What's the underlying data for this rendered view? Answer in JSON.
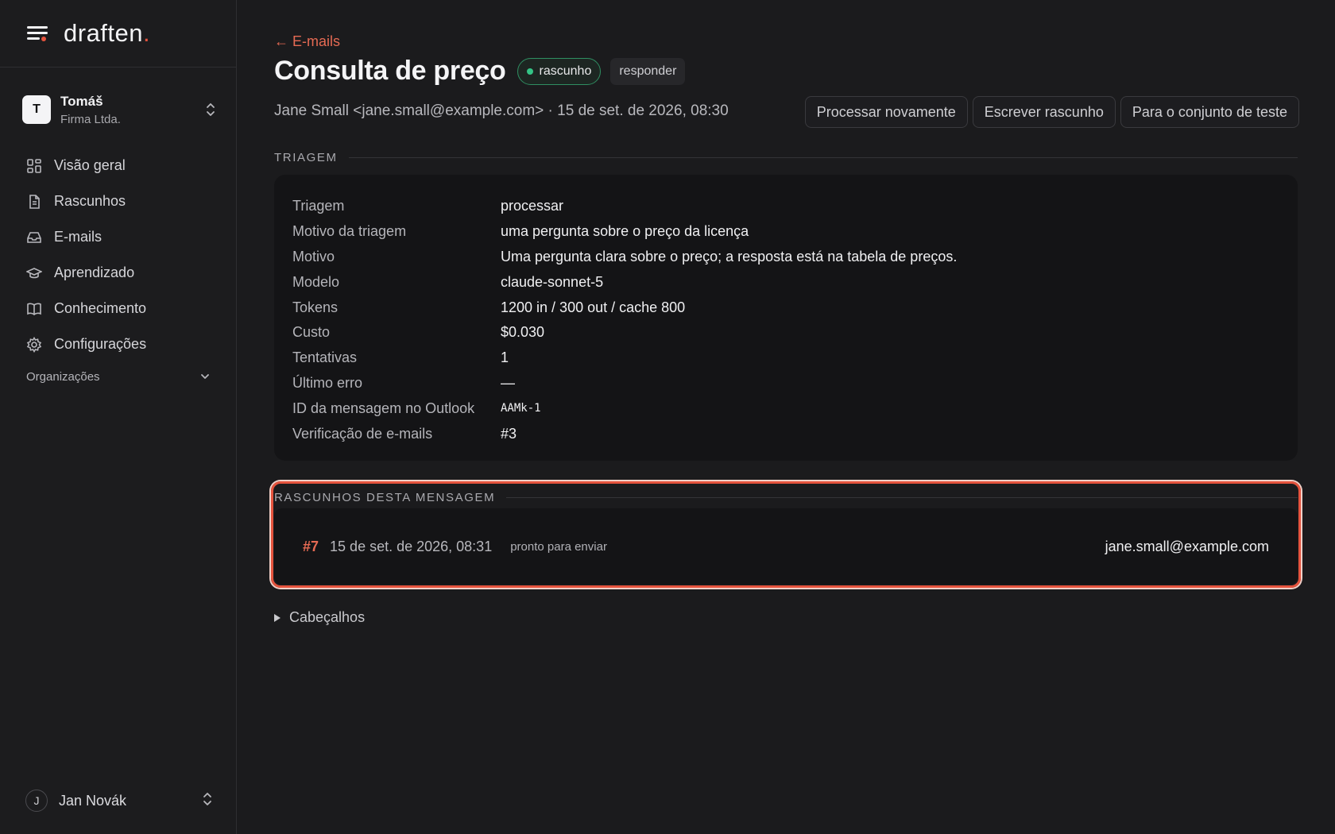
{
  "brand": {
    "name": "draften",
    "dot": "."
  },
  "org_switcher": {
    "avatar_letter": "T",
    "user": "Tomáš",
    "company": "Firma Ltda."
  },
  "nav": {
    "items": [
      {
        "label": "Visão geral",
        "icon": "grid-icon"
      },
      {
        "label": "Rascunhos",
        "icon": "document-icon"
      },
      {
        "label": "E-mails",
        "icon": "inbox-icon"
      },
      {
        "label": "Aprendizado",
        "icon": "graduation-cap-icon"
      },
      {
        "label": "Conhecimento",
        "icon": "book-icon"
      },
      {
        "label": "Configurações",
        "icon": "gear-icon"
      }
    ]
  },
  "orgs": {
    "label": "Organizações"
  },
  "user": {
    "avatar_letter": "J",
    "name": "Jan Novák"
  },
  "header": {
    "back": "← E-mails",
    "title": "Consulta de preço",
    "status_badge": "rascunho",
    "type_badge": "responder",
    "meta": "Jane Small <jane.small@example.com> · 15 de set. de 2026, 08:30"
  },
  "actions": {
    "reprocess": "Processar novamente",
    "write_draft": "Escrever rascunho",
    "to_test_set": "Para o conjunto de teste"
  },
  "triage": {
    "section_title": "TRIAGEM",
    "rows": [
      {
        "key": "Triagem",
        "value": "processar"
      },
      {
        "key": "Motivo da triagem",
        "value": "uma pergunta sobre o preço da licença"
      },
      {
        "key": "Motivo",
        "value": "Uma pergunta clara sobre o preço; a resposta está na tabela de preços."
      },
      {
        "key": "Modelo",
        "value": "claude-sonnet-5"
      },
      {
        "key": "Tokens",
        "value": "1200 in / 300 out / cache 800"
      },
      {
        "key": "Custo",
        "value": "$0.030"
      },
      {
        "key": "Tentativas",
        "value": "1"
      },
      {
        "key": "Último erro",
        "value": "—"
      },
      {
        "key": "ID da mensagem no Outlook",
        "value": "AAMk-1"
      },
      {
        "key": "Verificação de e-mails",
        "value": "#3"
      }
    ]
  },
  "drafts": {
    "section_title": "RASCUNHOS DESTA MENSAGEM",
    "items": [
      {
        "number": "#7",
        "date": "15 de set. de 2026, 08:31",
        "state": "pronto para enviar",
        "to": "jane.small@example.com"
      }
    ]
  },
  "headers_toggle": {
    "label": "Cabeçalhos"
  },
  "colors": {
    "accent": "#e5533d",
    "status_green": "#34c486",
    "background": "#1b1b1d"
  }
}
